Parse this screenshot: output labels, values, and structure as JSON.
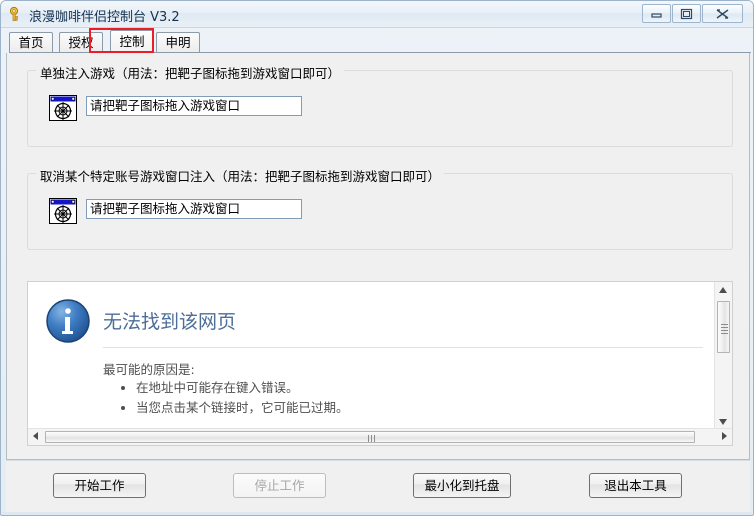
{
  "window": {
    "title": "浪漫咖啡伴侣控制台 V3.2",
    "app_icon": "key-icon",
    "controls": {
      "minimize": "minimize-icon",
      "maximize": "maximize-icon",
      "close": "close-icon"
    }
  },
  "tabs": [
    {
      "label": "首页",
      "selected": false
    },
    {
      "label": "授权",
      "selected": false
    },
    {
      "label": "控制",
      "selected": true
    },
    {
      "label": "申明",
      "selected": false
    }
  ],
  "annotation": {
    "type": "highlight-rectangle",
    "color": "#ee1c25",
    "target": "控制"
  },
  "groups": [
    {
      "title": "单独注入游戏（用法：把靶子图标拖到游戏窗口即可）",
      "icon": "target-crosshair-icon",
      "field_value": "请把靶子图标拖入游戏窗口"
    },
    {
      "title": "取消某个特定账号游戏窗口注入（用法：把靶子图标拖到游戏窗口即可）",
      "icon": "target-crosshair-icon",
      "field_value": "请把靶子图标拖入游戏窗口"
    }
  ],
  "webview": {
    "heading": "无法找到该网页",
    "heading_color": "#4d6e98",
    "icon": "info-icon",
    "reason_title": "最可能的原因是:",
    "reasons": [
      "在地址中可能存在键入错误。",
      "当您点击某个链接时，它可能已过期。"
    ]
  },
  "buttons": [
    {
      "label": "开始工作",
      "disabled": false
    },
    {
      "label": "停止工作",
      "disabled": true
    },
    {
      "label": "最小化到托盘",
      "disabled": false
    },
    {
      "label": "退出本工具",
      "disabled": false
    }
  ]
}
